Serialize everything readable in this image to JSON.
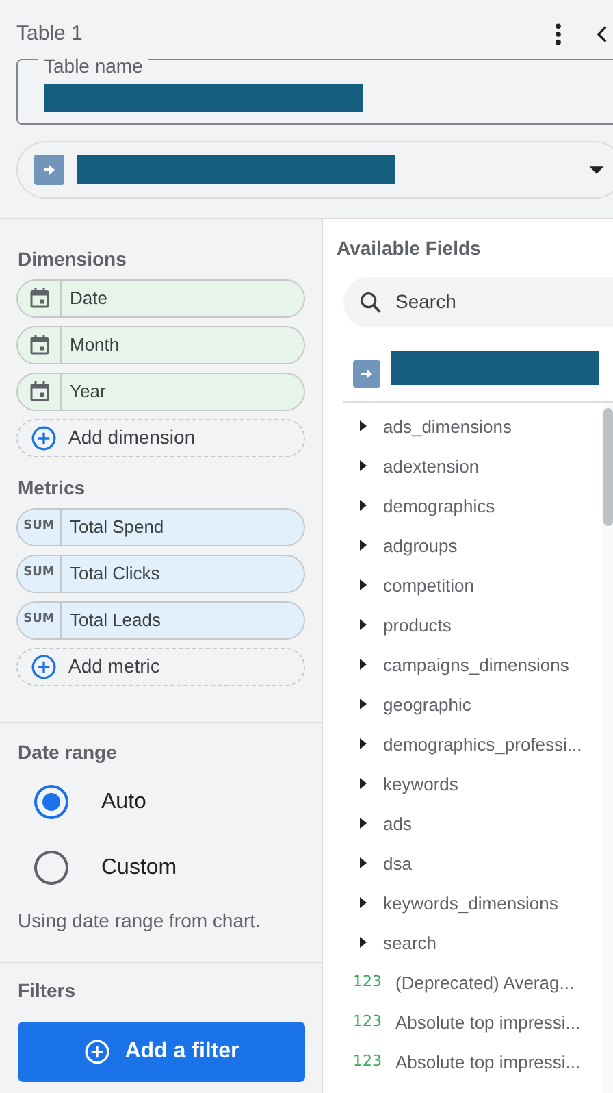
{
  "panel": {
    "title": "Table 1",
    "table_name": {
      "label": "Table name"
    }
  },
  "dimensions": {
    "heading": "Dimensions",
    "items": [
      {
        "kind": "date",
        "label": "Date"
      },
      {
        "kind": "date",
        "label": "Month"
      },
      {
        "kind": "date",
        "label": "Year"
      }
    ],
    "add_label": "Add dimension"
  },
  "metrics": {
    "heading": "Metrics",
    "items": [
      {
        "kind": "aggregate",
        "aggregation": "SUM",
        "label": "Total Spend"
      },
      {
        "kind": "aggregate",
        "aggregation": "SUM",
        "label": "Total Clicks"
      },
      {
        "kind": "aggregate",
        "aggregation": "SUM",
        "label": "Total Leads"
      }
    ],
    "add_label": "Add metric"
  },
  "date_range": {
    "heading": "Date range",
    "options": [
      {
        "label": "Auto",
        "selected": true
      },
      {
        "label": "Custom",
        "selected": false
      }
    ],
    "hint": "Using date range from chart."
  },
  "filters": {
    "heading": "Filters",
    "button": "Add a filter"
  },
  "available_fields": {
    "heading": "Available Fields",
    "search": {
      "placeholder": "Search"
    },
    "fields": [
      {
        "kind": "group",
        "label": "ads_dimensions"
      },
      {
        "kind": "group",
        "label": "adextension"
      },
      {
        "kind": "group",
        "label": "demographics"
      },
      {
        "kind": "group",
        "label": "adgroups"
      },
      {
        "kind": "group",
        "label": "competition"
      },
      {
        "kind": "group",
        "label": "products"
      },
      {
        "kind": "group",
        "label": "campaigns_dimensions"
      },
      {
        "kind": "group",
        "label": "geographic"
      },
      {
        "kind": "group",
        "label": "demographics_professi..."
      },
      {
        "kind": "group",
        "label": "keywords"
      },
      {
        "kind": "group",
        "label": "ads"
      },
      {
        "kind": "group",
        "label": "dsa"
      },
      {
        "kind": "group",
        "label": "keywords_dimensions"
      },
      {
        "kind": "group",
        "label": "search"
      },
      {
        "kind": "number",
        "type_label": "123",
        "label": "(Deprecated) Averag..."
      },
      {
        "kind": "number",
        "type_label": "123",
        "label": "Absolute top impressi..."
      },
      {
        "kind": "number",
        "type_label": "123",
        "label": "Absolute top impressi..."
      }
    ]
  }
}
